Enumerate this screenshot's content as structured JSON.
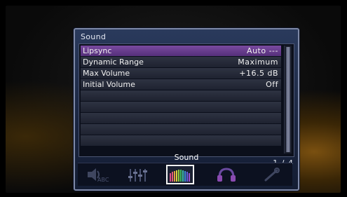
{
  "panel": {
    "title": "Sound"
  },
  "menu": {
    "items": [
      {
        "label": "Lipsync",
        "value": "Auto ---",
        "selected": true
      },
      {
        "label": "Dynamic Range",
        "value": "Maximum"
      },
      {
        "label": "Max Volume",
        "value": "+16.5 dB"
      },
      {
        "label": "Initial Volume",
        "value": "Off"
      },
      {
        "label": "",
        "value": ""
      },
      {
        "label": "",
        "value": ""
      },
      {
        "label": "",
        "value": ""
      },
      {
        "label": "",
        "value": ""
      }
    ]
  },
  "page_indicator": "1 / 4",
  "category": {
    "current_label": "Sound",
    "icons": [
      {
        "name": "speaker-abc-icon",
        "active": false
      },
      {
        "name": "sliders-icon",
        "active": false
      },
      {
        "name": "equalizer-icon",
        "active": true
      },
      {
        "name": "headphones-icon",
        "active": false
      },
      {
        "name": "wrench-icon",
        "active": false
      }
    ]
  },
  "colors": {
    "panel_bg": "#1a2540",
    "selection": "#7a4aa0",
    "row_bg": "#2e3342"
  }
}
